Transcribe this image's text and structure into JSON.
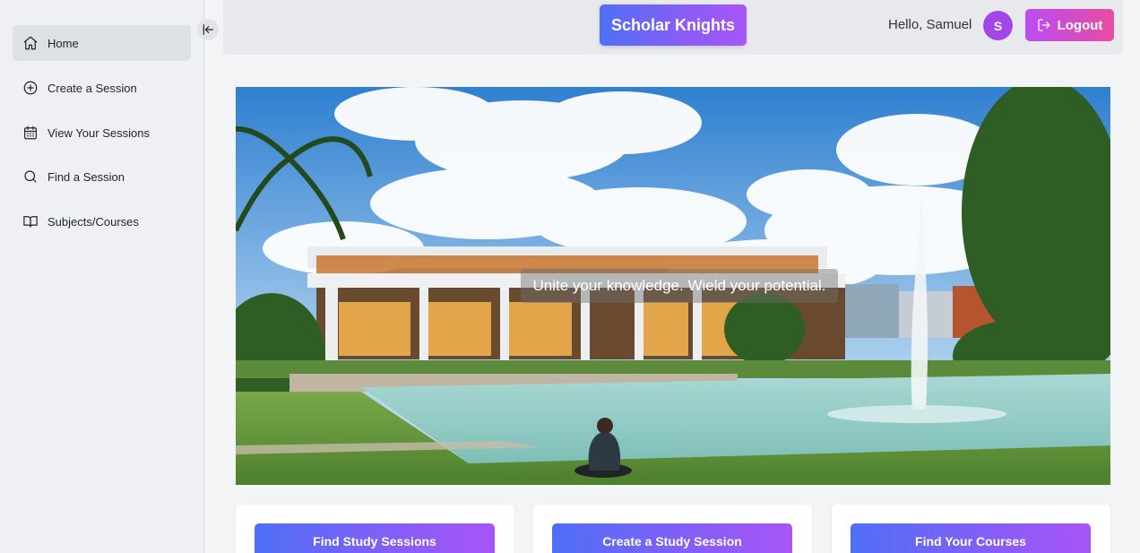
{
  "sidebar": {
    "items": [
      {
        "label": "Home",
        "icon": "home-icon",
        "active": true
      },
      {
        "label": "Create a Session",
        "icon": "plus-circle-icon"
      },
      {
        "label": "View Your Sessions",
        "icon": "calendar-icon"
      },
      {
        "label": "Find a Session",
        "icon": "search-icon"
      },
      {
        "label": "Subjects/Courses",
        "icon": "book-icon"
      }
    ],
    "collapse_icon": "collapse-left-icon"
  },
  "header": {
    "brand": "Scholar Knights",
    "greeting": "Hello, Samuel",
    "avatar_initial": "S",
    "logout_label": "Logout",
    "logout_icon": "logout-icon"
  },
  "hero": {
    "tagline": "Unite your knowledge. Wield your potential."
  },
  "cards": [
    {
      "button": "Find Study Sessions"
    },
    {
      "button": "Create a Study Session"
    },
    {
      "button": "Find Your Courses"
    }
  ],
  "colors": {
    "brand_gradient_start": "#4f6ff6",
    "brand_gradient_end": "#a855f7",
    "logout_gradient_start": "#b84ef5",
    "logout_gradient_end": "#e94ba0",
    "avatar": "#a445e8"
  }
}
